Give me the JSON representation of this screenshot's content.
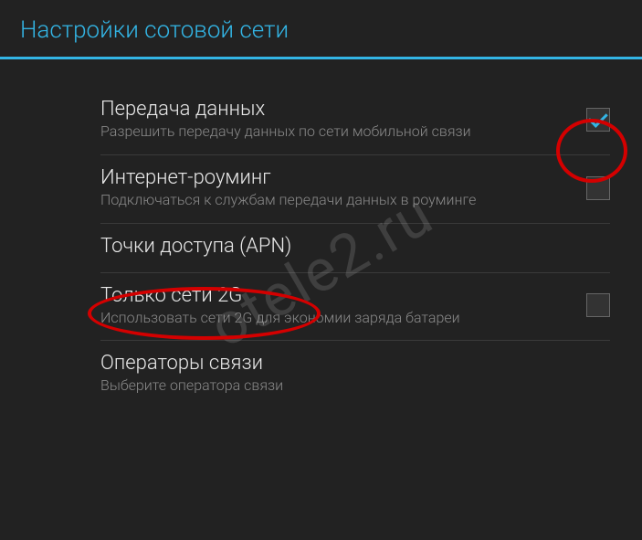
{
  "header": {
    "title": "Настройки сотовой сети"
  },
  "settings": [
    {
      "title": "Передача данных",
      "subtitle": "Разрешить передачу данных по сети мобильной связи",
      "hasCheckbox": true,
      "checked": true
    },
    {
      "title": "Интернет-роуминг",
      "subtitle": "Подключаться к службам передачи данных в роуминге",
      "hasCheckbox": true,
      "checked": false
    },
    {
      "title": "Точки доступа (APN)",
      "subtitle": "",
      "hasCheckbox": false,
      "checked": false
    },
    {
      "title": "Только сети 2G",
      "subtitle": "Использовать сети 2G для экономии заряда батареи",
      "hasCheckbox": true,
      "checked": false
    },
    {
      "title": "Операторы связи",
      "subtitle": "Выберите оператора связи",
      "hasCheckbox": false,
      "checked": false
    }
  ],
  "watermark": "otele2.ru",
  "annotations": {
    "circle1": "checkbox-highlight",
    "circle2": "apn-highlight"
  }
}
